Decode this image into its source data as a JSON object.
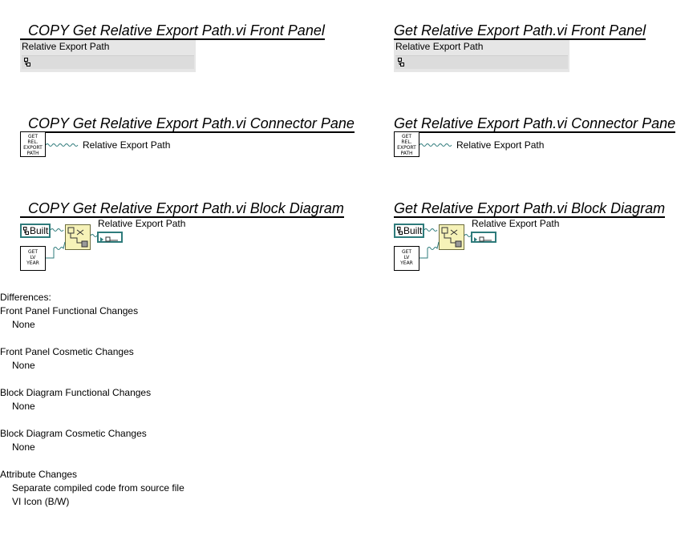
{
  "left": {
    "front_panel_title": "COPY  Get Relative Export Path.vi Front Panel",
    "connector_pane_title": "COPY  Get Relative Export Path.vi Connector Pane",
    "block_diagram_title": "COPY  Get Relative Export Path.vi Block Diagram"
  },
  "right": {
    "front_panel_title": "Get Relative Export Path.vi Front Panel",
    "connector_pane_title": "Get Relative Export Path.vi Connector Pane",
    "block_diagram_title": "Get Relative Export Path.vi Block Diagram"
  },
  "front_panel": {
    "indicator_label": "Relative Export Path"
  },
  "connector_pane": {
    "icon_lines": [
      "GET",
      "REL.",
      "EXPORT",
      "PATH"
    ],
    "terminal_label": "Relative Export Path"
  },
  "block_diagram": {
    "constant_label": "Built",
    "year_icon_lines": [
      "GET",
      "LV",
      "YEAR"
    ],
    "indicator_label": "Relative Export Path",
    "wire_color": "#2e7b7b",
    "node_color": "#f6f2b8"
  },
  "differences": {
    "header": "Differences:",
    "sections": [
      {
        "title": "Front Panel Functional Changes",
        "items": [
          "None"
        ]
      },
      {
        "title": "Front Panel Cosmetic Changes",
        "items": [
          "None"
        ]
      },
      {
        "title": "Block Diagram Functional Changes",
        "items": [
          "None"
        ]
      },
      {
        "title": "Block Diagram Cosmetic Changes",
        "items": [
          "None"
        ]
      },
      {
        "title": "Attribute Changes",
        "items": [
          "Separate compiled code from source file",
          "VI Icon (B/W)"
        ]
      }
    ]
  }
}
